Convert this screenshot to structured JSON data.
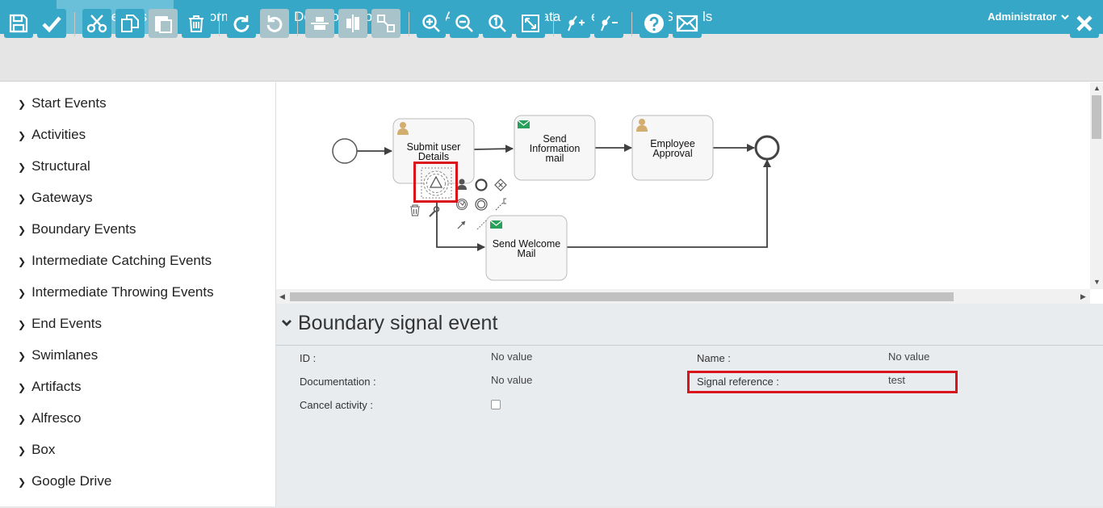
{
  "nav": {
    "tabs": [
      {
        "label": "Processes",
        "active": true
      },
      {
        "label": "Forms"
      },
      {
        "label": "Decision Tables"
      },
      {
        "label": "Apps"
      },
      {
        "label": "Data Models"
      },
      {
        "label": "Stencils"
      }
    ],
    "user": "Administrator",
    "colors": {
      "nav_bg": "#36a7c6",
      "active_tab": "#6ac0d8"
    }
  },
  "toolbar": {
    "icons": [
      "save-icon",
      "validate-icon",
      "cut-icon",
      "copy-icon",
      "paste-icon",
      "delete-icon",
      "redo-icon",
      "undo-icon",
      "align-vertical-icon",
      "align-horizontal-icon",
      "same-size-icon",
      "zoom-in-icon",
      "zoom-out-icon",
      "zoom-actual-icon",
      "zoom-fit-icon",
      "bend-point-add-icon",
      "bend-point-remove-icon",
      "help-icon",
      "feedback-icon",
      "close-icon"
    ]
  },
  "palette": {
    "items": [
      "Start Events",
      "Activities",
      "Structural",
      "Gateways",
      "Boundary Events",
      "Intermediate Catching Events",
      "Intermediate Throwing Events",
      "End Events",
      "Swimlanes",
      "Artifacts",
      "Alfresco",
      "Box",
      "Google Drive"
    ]
  },
  "diagram": {
    "tasks": {
      "submit": "Submit user Details",
      "send_info": "Send Information mail",
      "approval": "Employee Approval",
      "welcome": "Send Welcome Mail"
    },
    "context_icons": [
      "user-task-icon",
      "end-event-icon",
      "gateway-icon",
      "intermediate-event-icon",
      "boundary-event-icon",
      "wrench-icon",
      "trash-icon",
      "sequence-flow-icon",
      "association-icon",
      "text-annotation-icon"
    ]
  },
  "properties": {
    "title": "Boundary signal event",
    "id_label": "ID :",
    "id_value": "No value",
    "doc_label": "Documentation :",
    "doc_value": "No value",
    "cancel_label": "Cancel activity :",
    "cancel_checked": false,
    "name_label": "Name :",
    "name_value": "No value",
    "signal_label": "Signal reference :",
    "signal_value": "test"
  },
  "highlight_color": "#d9151b"
}
